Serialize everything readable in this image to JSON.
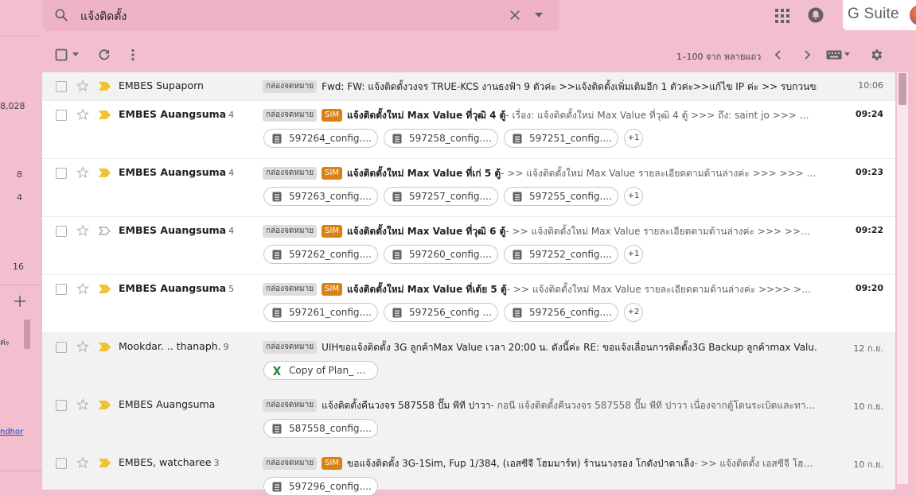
{
  "search": {
    "query": "แจ้งติดตั้ง"
  },
  "header": {
    "brand": "G Suite"
  },
  "left_panel": {
    "counts": [
      "8,028",
      "8",
      "4",
      "16"
    ],
    "snippet": "ค่ะ",
    "link": "ndhor"
  },
  "toolbar": {
    "pagination": "1–100 จาก หลายแถว"
  },
  "emails": [
    {
      "sender": "EMBES Supaporn",
      "count": "",
      "unread": false,
      "important": true,
      "inbox_tag": "กล่องจดหมาย",
      "sim": false,
      "subject": "Fwd: FW: แจ้งติดตั้งวงจร TRUE-KCS งานธงฟ้า 9 ตัวค่ะ >>แจ้งติดตั้งเพิ่มเติมอีก 1 ตัวค่ะ>>แก้ไข IP ค่ะ >> รบกวนขอใ...",
      "snippet": "",
      "time": "10:06",
      "attachments": [],
      "more": ""
    },
    {
      "sender": "EMBES Auangsuma",
      "count": "4",
      "unread": true,
      "important": true,
      "inbox_tag": "กล่องจดหมาย",
      "sim": true,
      "sim_label": "SIM",
      "subject": "แจ้งติดตั้งใหม่ Max Value ที่วุฒิ 4 ตู้",
      "snippet": " - เรื่อง: แจ้งติดตั้งใหม่ Max Value ที่วุฒิ 4 ตู้ >>> ถึง: saint jo >>> สำเน...",
      "time": "09:24",
      "attachments": [
        "597264_config....",
        "597258_config....",
        "597251_config...."
      ],
      "more": "+1"
    },
    {
      "sender": "EMBES Auangsuma",
      "count": "4",
      "unread": true,
      "important": true,
      "inbox_tag": "กล่องจดหมาย",
      "sim": true,
      "sim_label": "SIM",
      "subject": "แจ้งติดตั้งใหม่ Max Value ที่เก่ 5 ตู้",
      "snippet": " - >> แจ้งติดตั้งใหม่ Max Value รายละเอียดตามด้านล่างค่ะ >>> >>> >>> ...",
      "time": "09:23",
      "attachments": [
        "597263_config....",
        "597257_config....",
        "597255_config...."
      ],
      "more": "+1"
    },
    {
      "sender": "EMBES Auangsuma",
      "count": "4",
      "unread": true,
      "important": false,
      "inbox_tag": "กล่องจดหมาย",
      "sim": true,
      "sim_label": "SIM",
      "subject": "แจ้งติดตั้งใหม่ Max Value ที่วุฒิ 6 ตู้",
      "snippet": " - >> แจ้งติดตั้งใหม่ Max Value รายละเอียดตามด้านล่างค่ะ >>> >>> ใช้ง...",
      "time": "09:22",
      "attachments": [
        "597262_config....",
        "597260_config....",
        "597252_config...."
      ],
      "more": "+1"
    },
    {
      "sender": "EMBES Auangsuma",
      "count": "5",
      "unread": true,
      "important": true,
      "inbox_tag": "กล่องจดหมาย",
      "sim": true,
      "sim_label": "SIM",
      "subject": "แจ้งติดตั้งใหม่ Max Value ที่เต้ย 5 ตู้",
      "snippet": " - >> แจ้งติดตั้งใหม่ Max Value รายละเอียดตามด้านล่างค่ะ >>>> >>>> ...",
      "time": "09:20",
      "attachments": [
        "597261_config....",
        "597256_config ...",
        "597256_config...."
      ],
      "more": "+2"
    },
    {
      "sender": "Mookdar. .. thanaph.",
      "count": "9",
      "unread": false,
      "important": true,
      "inbox_tag": "กล่องจดหมาย",
      "sim": false,
      "subject": "UIHขอแจ้งติดตั้ง 3G ลูกค้าMax Value เวลา 20:00 น. ดังนี้ค่ะ RE: ขอแจ้งเลื่อนการติดตั้ง3G Backup ลูกค้าmax Valu...",
      "snippet": "",
      "time": "12 ก.ย.",
      "attachments": [
        "Copy of Plan_ ..."
      ],
      "excel": true,
      "more": ""
    },
    {
      "sender": "EMBES Auangsuma",
      "count": "",
      "unread": false,
      "important": true,
      "inbox_tag": "กล่องจดหมาย",
      "sim": false,
      "subject": "แจ้งติดตั้งคืนวงจร 587558 ปั๊ม พีที ปาวา",
      "snippet": " - กอนี แจ้งติดตั้งคืนวงจร 587558 ปั๊ม พีที ปาวา เนื่องจากตู้โดนระเบิดและทา...",
      "time": "10 ก.ย.",
      "attachments": [
        "587558_config...."
      ],
      "more": ""
    },
    {
      "sender": "EMBES, watcharee",
      "count": "3",
      "unread": false,
      "important": true,
      "inbox_tag": "กล่องจดหมาย",
      "sim": true,
      "sim_label": "SIM",
      "subject": "ขอแจ้งติดตั้ง 3G-1Sim, Fup 1/384, (เอสซีจี โฮมมาร์ท) ร้านนางรอง โกดังป่าตาเล็ง",
      "snippet": " - >> แจ้งติดตั้ง เอสซีจี โฮม...",
      "time": "10 ก.ย.",
      "attachments": [
        "597296_config...."
      ],
      "more": ""
    }
  ]
}
